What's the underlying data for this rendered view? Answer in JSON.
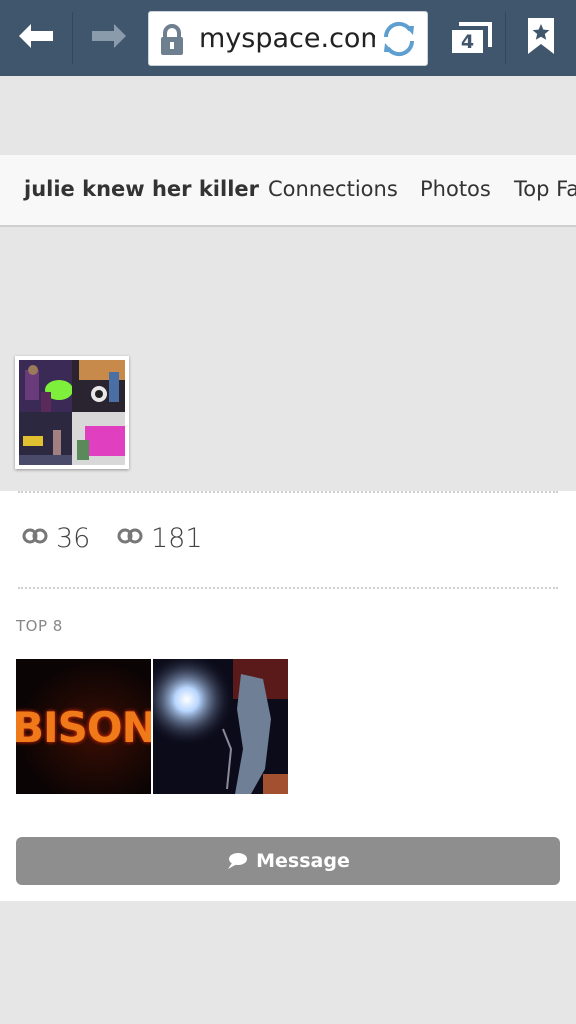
{
  "browser": {
    "url": "myspace.com",
    "tab_count": "4",
    "icons": {
      "back": "arrow-left-icon",
      "forward": "arrow-right-icon",
      "secure": "lock-icon",
      "reload": "refresh-icon",
      "tabs": "tabs-icon",
      "bookmark": "bookmark-star-icon"
    }
  },
  "profile": {
    "name": "julie knew her killer",
    "nav": [
      "Connections",
      "Photos",
      "Top Fans"
    ]
  },
  "stats": [
    {
      "icon": "connections-icon",
      "value": "36"
    },
    {
      "icon": "connections-icon",
      "value": "181"
    }
  ],
  "top8": {
    "label": "TOP 8",
    "items": [
      {
        "image_text": "BISON"
      },
      {
        "image_text": ""
      }
    ]
  },
  "actions": {
    "message_label": "Message"
  },
  "colors": {
    "toolbar": "#3f566c",
    "page_bg": "#e6e6e6",
    "button": "#8e8e8e"
  }
}
